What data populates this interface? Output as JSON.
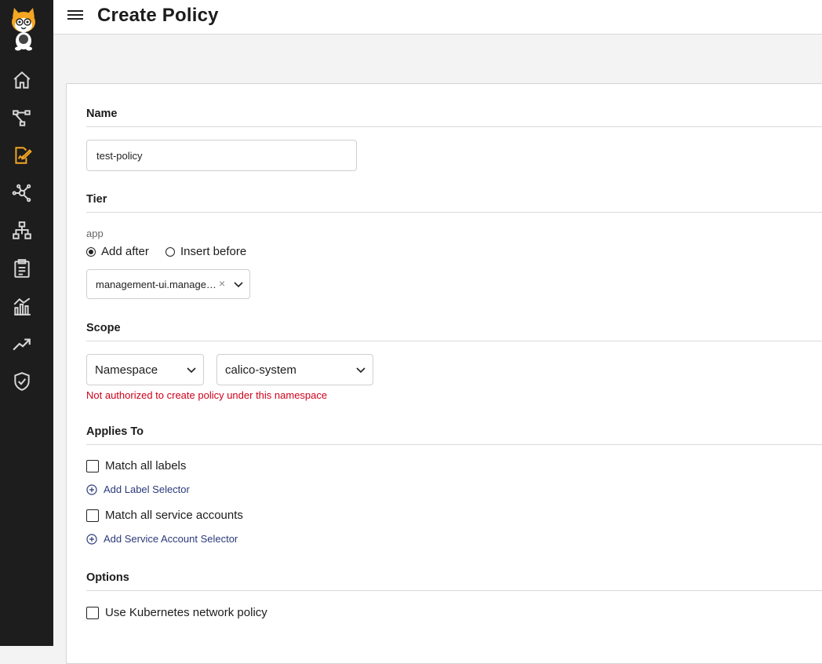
{
  "header": {
    "title": "Create Policy"
  },
  "sidebar": {
    "items": [
      {
        "icon": "home-icon"
      },
      {
        "icon": "topology-icon"
      },
      {
        "icon": "policy-edit-icon",
        "active": true
      },
      {
        "icon": "network-graph-icon"
      },
      {
        "icon": "hierarchy-icon"
      },
      {
        "icon": "clipboard-icon"
      },
      {
        "icon": "bar-chart-icon"
      },
      {
        "icon": "trend-up-icon"
      },
      {
        "icon": "shield-check-icon"
      }
    ],
    "accent_color": "#f5a623"
  },
  "form": {
    "name": {
      "label": "Name",
      "value": "test-policy"
    },
    "tier": {
      "label": "Tier",
      "current_tier": "app",
      "radio_add_after": "Add after",
      "radio_insert_before": "Insert before",
      "selected_radio": "Add after",
      "selected_policy": "management-ui.management-ui",
      "clear_symbol": "×"
    },
    "scope": {
      "label": "Scope",
      "scope_type": "Namespace",
      "namespace": "calico-system",
      "error": "Not authorized to create policy under this namespace",
      "error_color": "#d0021b"
    },
    "applies_to": {
      "label": "Applies To",
      "match_all_labels": "Match all labels",
      "add_label_selector": "Add Label Selector",
      "match_all_service_accounts": "Match all service accounts",
      "add_service_account_selector": "Add Service Account Selector"
    },
    "options": {
      "label": "Options",
      "use_k8s_policy": "Use Kubernetes network policy"
    }
  }
}
